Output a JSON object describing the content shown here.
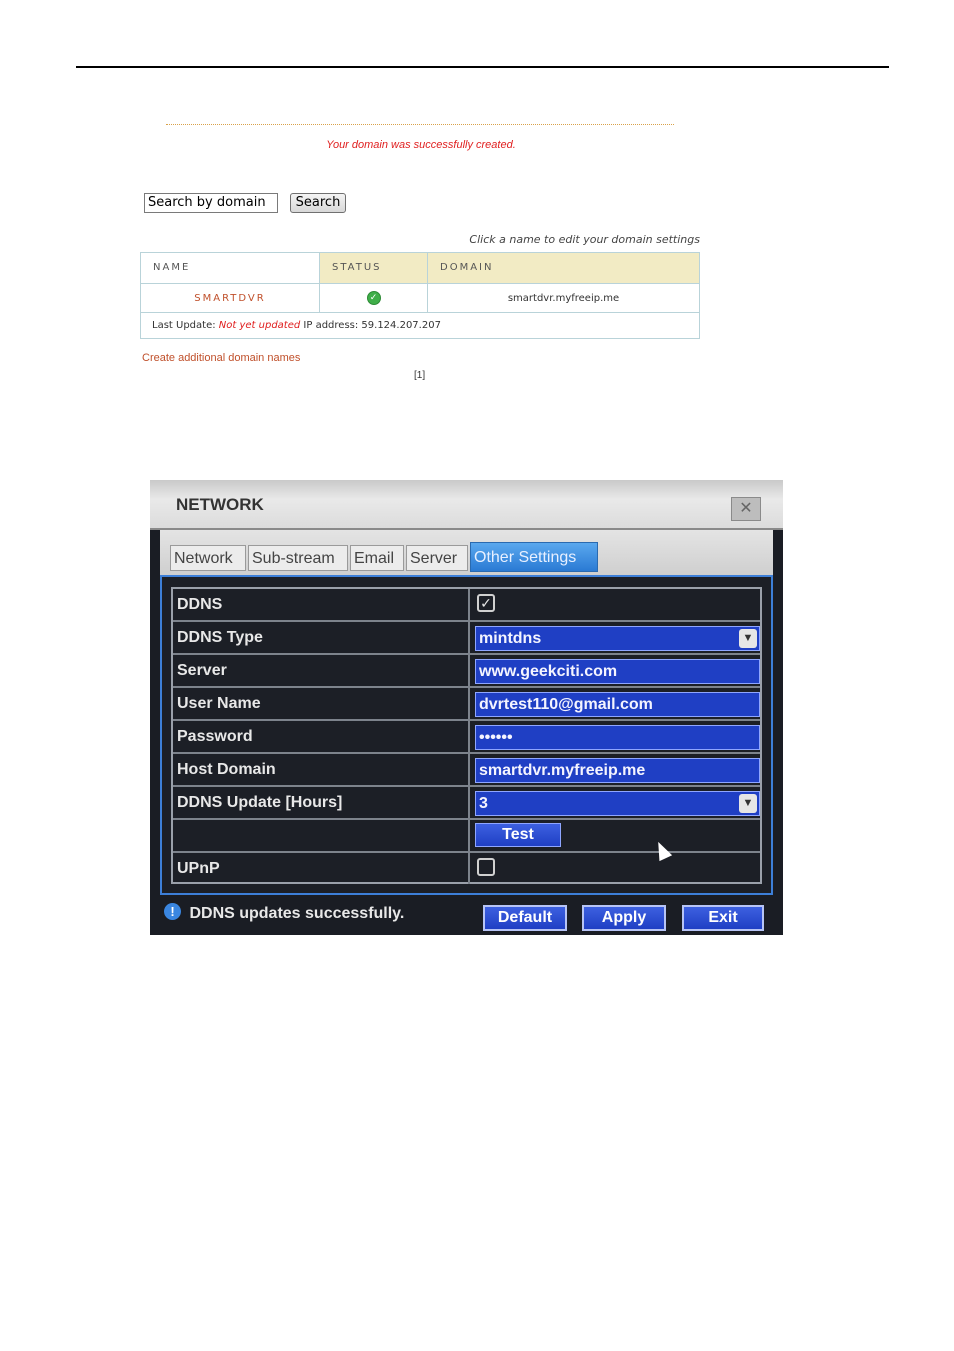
{
  "domain_page": {
    "success_message": "Your domain was successfully created.",
    "search": {
      "value": "Search by domain",
      "button": "Search"
    },
    "hint": "Click a name to edit your domain settings",
    "table": {
      "headers": [
        "NAME",
        "STATUS",
        "DOMAIN"
      ],
      "row": {
        "name": "SMARTDVR",
        "status_icon": "check-circle-icon",
        "domain": "smartdvr.myfreeip.me"
      },
      "footer": {
        "last_update_label": "Last Update:",
        "last_update_value": "Not yet updated",
        "ip_text": "IP address: 59.124.207.207"
      }
    },
    "create_link": "Create additional domain names",
    "pager": "[1]"
  },
  "dvr": {
    "title": "NETWORK",
    "tabs": [
      "Network",
      "Sub-stream",
      "Email",
      "Server",
      "Other Settings"
    ],
    "active_tab": "Other Settings",
    "rows": {
      "ddns": {
        "label": "DDNS",
        "checked": true
      },
      "ddns_type": {
        "label": "DDNS Type",
        "value": "mintdns"
      },
      "server": {
        "label": "Server",
        "value": "www.geekciti.com"
      },
      "user_name": {
        "label": "User Name",
        "value": "dvrtest110@gmail.com"
      },
      "password": {
        "label": "Password",
        "value": "••••••"
      },
      "host_domain": {
        "label": "Host Domain",
        "value": "smartdvr.myfreeip.me"
      },
      "ddns_update": {
        "label": "DDNS Update [Hours]",
        "value": "3"
      },
      "test": {
        "button": "Test"
      },
      "upnp": {
        "label": "UPnP",
        "checked": false
      }
    },
    "status_message": "DDNS updates successfully.",
    "buttons": {
      "default": "Default",
      "apply": "Apply",
      "exit": "Exit"
    },
    "colors": {
      "field_blue": "#1f3fc4",
      "panel_border": "#3d7fd8",
      "success_red": "#e02020",
      "header_tan": "#f2ebc4"
    }
  }
}
